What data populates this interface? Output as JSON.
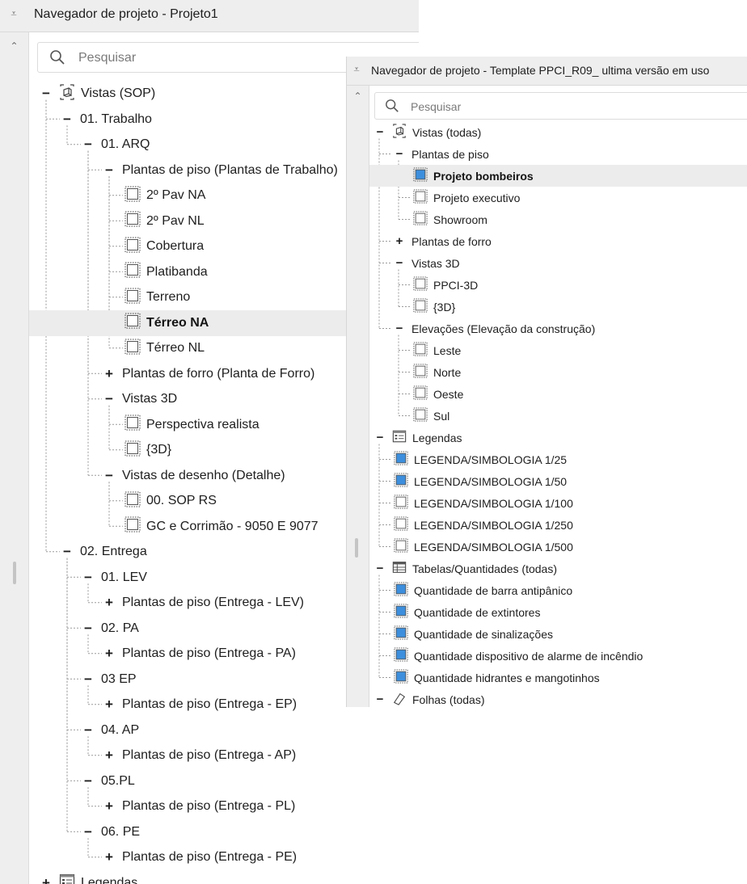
{
  "panel1": {
    "title": "Navegador de projeto - Projeto1",
    "search_placeholder": "Pesquisar",
    "rows": [
      {
        "depth": 0,
        "toggle": "−",
        "icon": "views-icon",
        "label": "Vistas (SOP)"
      },
      {
        "depth": 1,
        "toggle": "−",
        "icon": "",
        "label": "01. Trabalho"
      },
      {
        "depth": 2,
        "toggle": "−",
        "icon": "",
        "label": "01. ARQ"
      },
      {
        "depth": 3,
        "toggle": "−",
        "icon": "",
        "label": "Plantas de piso (Plantas de Trabalho)"
      },
      {
        "depth": 4,
        "toggle": "",
        "icon": "view-icon",
        "label": "2º Pav NA"
      },
      {
        "depth": 4,
        "toggle": "",
        "icon": "view-icon",
        "label": "2º Pav NL"
      },
      {
        "depth": 4,
        "toggle": "",
        "icon": "view-icon",
        "label": "Cobertura"
      },
      {
        "depth": 4,
        "toggle": "",
        "icon": "view-icon",
        "label": "Platibanda"
      },
      {
        "depth": 4,
        "toggle": "",
        "icon": "view-icon",
        "label": "Terreno"
      },
      {
        "depth": 4,
        "toggle": "",
        "icon": "view-icon",
        "label": "Térreo NA",
        "selected": true,
        "bold": true
      },
      {
        "depth": 4,
        "toggle": "",
        "icon": "view-icon",
        "label": "Térreo NL"
      },
      {
        "depth": 3,
        "toggle": "+",
        "icon": "",
        "label": "Plantas de forro (Planta de Forro)"
      },
      {
        "depth": 3,
        "toggle": "−",
        "icon": "",
        "label": "Vistas 3D"
      },
      {
        "depth": 4,
        "toggle": "",
        "icon": "view-icon",
        "label": "Perspectiva realista"
      },
      {
        "depth": 4,
        "toggle": "",
        "icon": "view-icon",
        "label": "{3D}"
      },
      {
        "depth": 3,
        "toggle": "−",
        "icon": "",
        "label": "Vistas de desenho (Detalhe)"
      },
      {
        "depth": 4,
        "toggle": "",
        "icon": "view-icon",
        "label": "00. SOP RS"
      },
      {
        "depth": 4,
        "toggle": "",
        "icon": "view-icon",
        "label": "GC e Corrimão - 9050 E 9077"
      },
      {
        "depth": 1,
        "toggle": "−",
        "icon": "",
        "label": "02. Entrega"
      },
      {
        "depth": 2,
        "toggle": "−",
        "icon": "",
        "label": "01. LEV"
      },
      {
        "depth": 3,
        "toggle": "+",
        "icon": "",
        "label": "Plantas de piso (Entrega - LEV)"
      },
      {
        "depth": 2,
        "toggle": "−",
        "icon": "",
        "label": "02. PA"
      },
      {
        "depth": 3,
        "toggle": "+",
        "icon": "",
        "label": "Plantas de piso (Entrega - PA)"
      },
      {
        "depth": 2,
        "toggle": "−",
        "icon": "",
        "label": "03 EP"
      },
      {
        "depth": 3,
        "toggle": "+",
        "icon": "",
        "label": "Plantas de piso (Entrega - EP)"
      },
      {
        "depth": 2,
        "toggle": "−",
        "icon": "",
        "label": "04. AP"
      },
      {
        "depth": 3,
        "toggle": "+",
        "icon": "",
        "label": "Plantas de piso (Entrega - AP)"
      },
      {
        "depth": 2,
        "toggle": "−",
        "icon": "",
        "label": "05.PL"
      },
      {
        "depth": 3,
        "toggle": "+",
        "icon": "",
        "label": "Plantas de piso (Entrega - PL)"
      },
      {
        "depth": 2,
        "toggle": "−",
        "icon": "",
        "label": "06. PE"
      },
      {
        "depth": 3,
        "toggle": "+",
        "icon": "",
        "label": "Plantas de piso (Entrega - PE)"
      },
      {
        "depth": 0,
        "toggle": "+",
        "icon": "legend-icon",
        "label": "Legendas"
      }
    ]
  },
  "panel2": {
    "title": "Navegador de projeto - Template PPCI_R09_ ultima versão em uso",
    "search_placeholder": "Pesquisar",
    "rows": [
      {
        "depth": 0,
        "toggle": "−",
        "icon": "views-icon",
        "label": "Vistas (todas)"
      },
      {
        "depth": 1,
        "toggle": "−",
        "icon": "",
        "label": "Plantas de piso"
      },
      {
        "depth": 2,
        "toggle": "",
        "icon": "view-blue-icon",
        "label": "Projeto bombeiros",
        "selected": true,
        "bold": true
      },
      {
        "depth": 2,
        "toggle": "",
        "icon": "view-icon",
        "label": "Projeto executivo"
      },
      {
        "depth": 2,
        "toggle": "",
        "icon": "view-icon",
        "label": "Showroom"
      },
      {
        "depth": 1,
        "toggle": "+",
        "icon": "",
        "label": "Plantas de forro"
      },
      {
        "depth": 1,
        "toggle": "−",
        "icon": "",
        "label": "Vistas 3D"
      },
      {
        "depth": 2,
        "toggle": "",
        "icon": "view-icon",
        "label": "PPCI-3D"
      },
      {
        "depth": 2,
        "toggle": "",
        "icon": "view-icon",
        "label": "{3D}"
      },
      {
        "depth": 1,
        "toggle": "−",
        "icon": "",
        "label": "Elevações (Elevação da construção)"
      },
      {
        "depth": 2,
        "toggle": "",
        "icon": "view-icon",
        "label": "Leste"
      },
      {
        "depth": 2,
        "toggle": "",
        "icon": "view-icon",
        "label": "Norte"
      },
      {
        "depth": 2,
        "toggle": "",
        "icon": "view-icon",
        "label": "Oeste"
      },
      {
        "depth": 2,
        "toggle": "",
        "icon": "view-icon",
        "label": "Sul"
      },
      {
        "depth": 0,
        "toggle": "−",
        "icon": "legend-icon",
        "label": "Legendas"
      },
      {
        "depth": 1,
        "toggle": "",
        "icon": "view-blue-icon",
        "label": "LEGENDA/SIMBOLOGIA 1/25"
      },
      {
        "depth": 1,
        "toggle": "",
        "icon": "view-blue-icon",
        "label": "LEGENDA/SIMBOLOGIA 1/50"
      },
      {
        "depth": 1,
        "toggle": "",
        "icon": "view-icon",
        "label": "LEGENDA/SIMBOLOGIA 1/100"
      },
      {
        "depth": 1,
        "toggle": "",
        "icon": "view-icon",
        "label": "LEGENDA/SIMBOLOGIA 1/250"
      },
      {
        "depth": 1,
        "toggle": "",
        "icon": "view-icon",
        "label": "LEGENDA/SIMBOLOGIA 1/500"
      },
      {
        "depth": 0,
        "toggle": "−",
        "icon": "schedule-icon",
        "label": "Tabelas/Quantidades (todas)"
      },
      {
        "depth": 1,
        "toggle": "",
        "icon": "view-blue-icon",
        "label": "Quantidade de barra antipânico"
      },
      {
        "depth": 1,
        "toggle": "",
        "icon": "view-blue-icon",
        "label": "Quantidade de extintores"
      },
      {
        "depth": 1,
        "toggle": "",
        "icon": "view-blue-icon",
        "label": "Quantidade de sinalizações"
      },
      {
        "depth": 1,
        "toggle": "",
        "icon": "view-blue-icon",
        "label": "Quantidade dispositivo de alarme de incêndio"
      },
      {
        "depth": 1,
        "toggle": "",
        "icon": "view-blue-icon",
        "label": "Quantidade hidrantes e mangotinhos"
      },
      {
        "depth": 0,
        "toggle": "−",
        "icon": "sheets-icon",
        "label": "Folhas (todas)"
      }
    ]
  },
  "colors": {
    "accent_blue": "#3d8fdd",
    "selection": "#ececec",
    "tree_lines": "#9a9a9a"
  }
}
